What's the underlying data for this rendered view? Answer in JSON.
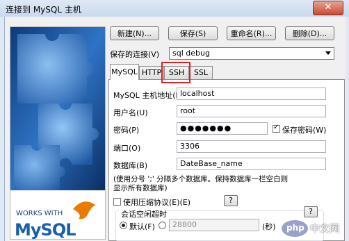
{
  "window": {
    "title": "连接到 MySQL 主机",
    "close_label": "✕"
  },
  "branding": {
    "tagline": "WORKS WITH",
    "logo_text": "MySQL"
  },
  "toolbar": {
    "new_label": "新建(N)...",
    "save_label": "保存(S)",
    "rename_label": "重命名(R)...",
    "delete_label": "删除(D)..."
  },
  "saved_connection": {
    "label": "保存的连接(V)",
    "value": "sql debug"
  },
  "tabs": [
    {
      "label": "MySQL",
      "active": true
    },
    {
      "label": "HTTP",
      "active": false
    },
    {
      "label": "SSH",
      "active": false
    },
    {
      "label": "SSL",
      "active": false
    }
  ],
  "form": {
    "host_label": "MySQL 主机地址(M)",
    "host_value": "localhost",
    "user_label": "用户名(U)",
    "user_value": "root",
    "password_label": "密码(P)",
    "password_value": "●●●●●●●",
    "save_password_label": "保存密码(W)",
    "save_password_checked": true,
    "port_label": "端口(O)",
    "port_value": "3306",
    "database_label": "数据库(B)",
    "database_value": "DateBase_name",
    "database_hint_line1": "(使用分号 ';' 分隔多个数据库。保持数据库一栏空白则",
    "database_hint_line2": "显示所有数据库)",
    "compression_label": "使用压缩协议(E)(E)",
    "help_label": "?",
    "session_timeout_label": "会话空闲超时",
    "default_label": "默认(F)",
    "timeout_value": "28800",
    "seconds_label": "(秒)"
  },
  "watermark": {
    "text": "中文网",
    "logo": "php"
  },
  "colors": {
    "highlight": "#d6242a",
    "accent": "#1a5fa8"
  }
}
